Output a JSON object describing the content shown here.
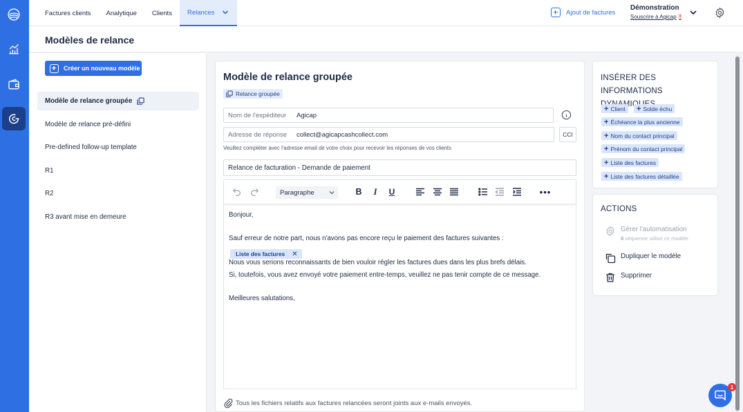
{
  "rail": {
    "items": [
      "logo",
      "analytics",
      "wallet",
      "cash-collect"
    ]
  },
  "topnav": {
    "tabs": [
      {
        "label": "Factures clients"
      },
      {
        "label": "Analytique"
      },
      {
        "label": "Clients"
      },
      {
        "label": "Relances"
      }
    ],
    "add_invoices_label": "Ajout de factures",
    "account_name": "Démonstration",
    "account_sub": "Souscrire à Agicap",
    "account_sub_badge": "!"
  },
  "page": {
    "title": "Modèles de relance"
  },
  "sidebar": {
    "create_label": "Créer un nouveau modèle",
    "templates": [
      {
        "label": "Modèle de relance groupée"
      },
      {
        "label": "Modèle de relance pré-défini"
      },
      {
        "label": "Pre-defined follow-up template"
      },
      {
        "label": "R1"
      },
      {
        "label": "R2"
      },
      {
        "label": "R3 avant mise en demeure"
      }
    ]
  },
  "editor": {
    "title": "Modèle de relance groupée",
    "type_badge": "Relance groupée",
    "sender_label": "Nom de l'expéditeur",
    "sender_value": "Agicap",
    "reply_label": "Adresse de réponse",
    "reply_value": "collect@agicapcashcollect.com",
    "cci_label": "CCI",
    "reply_hint": "Veuillez compléter avec l'adresse email de votre choix pour recevoir les réponses de vos clients",
    "subject": "Relance de facturation - Demande de paiement",
    "paragraph_select": "Paragraphe",
    "body": {
      "greeting": "Bonjour,",
      "line1": "Sauf erreur de notre part, nous n'avons pas encore reçu le paiement des factures suivantes :",
      "chip": "Liste des factures",
      "chip_remove": "✕",
      "line2": "Nous vous serions reconnaissants de bien vouloir régler les factures dues dans les plus brefs délais.",
      "line3": "Si, toutefois, vous avez envoyé votre paiement entre-temps, veuillez ne pas tenir compte de ce message.",
      "closing": "Meilleures salutations,"
    },
    "attachments_note": "Tous les fichiers relatifs aux factures relancées seront joints aux e-mails envoyés."
  },
  "dynamic": {
    "title": "INSÉRER DES INFORMATIONS DYNAMIQUES",
    "plus": "+",
    "chips": [
      {
        "label": "Client"
      },
      {
        "label": "Solde échu"
      },
      {
        "label": "Échéance la plus ancienne"
      },
      {
        "label": "Nom du contact principal"
      },
      {
        "label": "Prénom du contact principal"
      },
      {
        "label": "Liste des factures"
      },
      {
        "label": "Liste des factures détaillée"
      }
    ]
  },
  "actions": {
    "title": "ACTIONS",
    "manage_label": "Gérer l'automatisation",
    "manage_count": "0",
    "manage_sub": " séquence utilise ce modèle",
    "duplicate_label": "Dupliquer le modèle",
    "delete_label": "Supprimer"
  },
  "chat": {
    "badge": "1"
  },
  "colors": {
    "brand": "#2f6fe4",
    "rail_active": "#1c3f8a",
    "chip_bg": "#d9e5fa"
  }
}
